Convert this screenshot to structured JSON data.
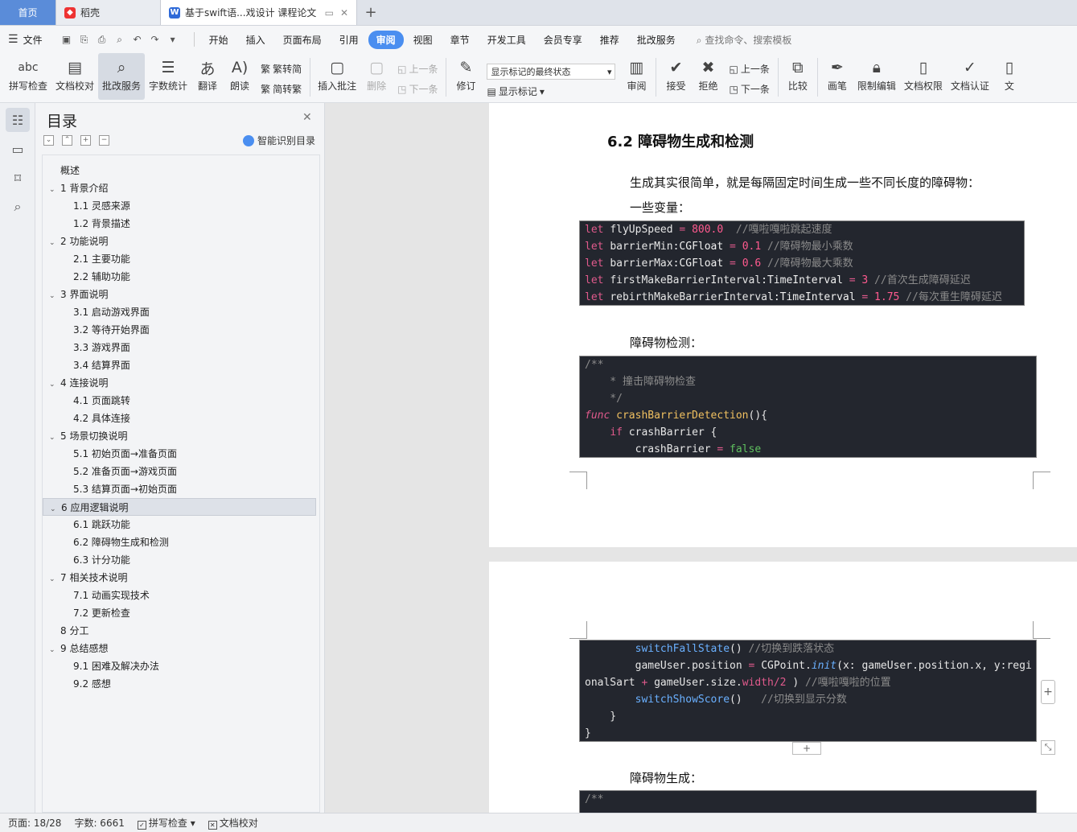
{
  "tabs": {
    "home": "首页",
    "daoke": "稻壳",
    "doc": "基于swift语...戏设计 课程论文"
  },
  "menu": {
    "file": "文件",
    "items": [
      "开始",
      "插入",
      "页面布局",
      "引用",
      "审阅",
      "视图",
      "章节",
      "开发工具",
      "会员专享",
      "推荐",
      "批改服务"
    ],
    "active": "审阅",
    "search": "查找命令、搜索模板"
  },
  "ribbon": {
    "spell": "拼写检查",
    "proof": "文档校对",
    "review_service": "批改服务",
    "wordcount": "字数统计",
    "translate": "翻译",
    "read": "朗读",
    "trad": "繁转简",
    "simp": "简转繁",
    "add_comment": "插入批注",
    "delete": "删除",
    "prev": "上一条",
    "next": "下一条",
    "track": "修订",
    "show_mode": "显示标记的最终状态",
    "show_marks": "显示标记",
    "review": "审阅",
    "accept": "接受",
    "reject": "拒绝",
    "prev2": "上一条",
    "next2": "下一条",
    "compare": "比较",
    "pen": "画笔",
    "restrict": "限制编辑",
    "permission": "文档权限",
    "cert": "文档认证",
    "more": "文"
  },
  "toc": {
    "title": "目录",
    "smart": "智能识别目录",
    "items": [
      {
        "level": 0,
        "text": "概述"
      },
      {
        "level": 1,
        "text": "1 背景介绍"
      },
      {
        "level": 2,
        "text": "1.1 灵感来源"
      },
      {
        "level": 2,
        "text": "1.2 背景描述"
      },
      {
        "level": 1,
        "text": "2 功能说明"
      },
      {
        "level": 2,
        "text": "2.1  主要功能"
      },
      {
        "level": 2,
        "text": "2.2 辅助功能"
      },
      {
        "level": 1,
        "text": "3 界面说明"
      },
      {
        "level": 2,
        "text": "3.1  启动游戏界面"
      },
      {
        "level": 2,
        "text": "3.2  等待开始界面"
      },
      {
        "level": 2,
        "text": "3.3  游戏界面"
      },
      {
        "level": 2,
        "text": "3.4  结算界面"
      },
      {
        "level": 1,
        "text": "4 连接说明"
      },
      {
        "level": 2,
        "text": "4.1  页面跳转"
      },
      {
        "level": 2,
        "text": "4.2  具体连接"
      },
      {
        "level": 1,
        "text": "5 场景切换说明"
      },
      {
        "level": 2,
        "text": "5.1 初始页面→准备页面"
      },
      {
        "level": 2,
        "text": "5.2 准备页面→游戏页面"
      },
      {
        "level": 2,
        "text": "5.3 结算页面→初始页面"
      },
      {
        "level": 1,
        "text": "6 应用逻辑说明",
        "selected": true
      },
      {
        "level": 2,
        "text": "6.1  跳跃功能"
      },
      {
        "level": 2,
        "text": "6.2  障碍物生成和检测"
      },
      {
        "level": 2,
        "text": "6.3  计分功能"
      },
      {
        "level": 1,
        "text": "7 相关技术说明"
      },
      {
        "level": 2,
        "text": "7.1 动画实现技术"
      },
      {
        "level": 2,
        "text": "7.2 更新检查"
      },
      {
        "level": 0,
        "text": "8 分工"
      },
      {
        "level": 1,
        "text": "9 总结感想"
      },
      {
        "level": 2,
        "text": "9.1  困难及解决办法"
      },
      {
        "level": 2,
        "text": "9.2  感想"
      }
    ]
  },
  "doc": {
    "heading": "6.2  障碍物生成和检测",
    "p1": "生成其实很简单，就是每隔固定时间生成一些不同长度的障碍物：",
    "p2": "一些变量：",
    "p3": "障碍物检测：",
    "p4": "障碍物生成：",
    "code1": [
      {
        "kw": "let",
        "name": "flyUpSpeed",
        "type": "",
        "op": "=",
        "val": "800.0",
        "cm": "  //嘎啦嘎啦跳起速度"
      },
      {
        "kw": "let",
        "name": "barrierMin",
        "type": ":CGFloat",
        "op": "=",
        "val": "0.1",
        "cm": " //障碍物最小乘数"
      },
      {
        "kw": "let",
        "name": "barrierMax",
        "type": ":CGFloat",
        "op": "=",
        "val": "0.6",
        "cm": " //障碍物最大乘数"
      },
      {
        "kw": "let",
        "name": "firstMakeBarrierInterval",
        "type": ":TimeInterval",
        "op": "=",
        "val": "3",
        "cm": " //首次生成障碍延迟"
      },
      {
        "kw": "let",
        "name": "rebirthMakeBarrierInterval",
        "type": ":TimeInterval",
        "op": "=",
        "val": "1.75",
        "cm": " //每次重生障碍延迟"
      }
    ],
    "code2": {
      "c1": "/**",
      "c2": "    * 撞击障碍物检查",
      "c3": "    */",
      "func": "func",
      "fname": "crashBarrierDetection",
      "paren": "(){",
      "if": "if",
      "cond": "crashBarrier",
      "brace": " {",
      "assign": "crashBarrier",
      "eq": " = ",
      "bool": "false"
    },
    "code3": {
      "l1fn": "switchFallState",
      "l1p": "()",
      "l1c": " //切换到跌落状态",
      "l2a": "gameUser",
      "l2b": ".position",
      "l2c": " = ",
      "l2d": "CGPoint",
      "l2e": ".",
      "l2f": "init",
      "l2g": "(x: ",
      "l2h": "gameUser",
      "l2i": ".position.x, y:",
      "l2j": "regi",
      "l3a": "onalSart",
      "l3b": " + ",
      "l3c": "gameUser",
      "l3d": ".size.",
      "l3e": "width",
      "l3f": "/2",
      "l3g": " ) ",
      "l3h": "//嘎啦嘎啦的位置",
      "l4fn": "switchShowScore",
      "l4p": "()",
      "l4c": "   //切换到显示分数",
      "l5": "    }",
      "l6": "}"
    },
    "code4": {
      "c1": "/**"
    }
  },
  "status": {
    "page": "页面: 18/28",
    "words": "字数: 6661",
    "spell": "拼写检查",
    "proof": "文档校对"
  }
}
